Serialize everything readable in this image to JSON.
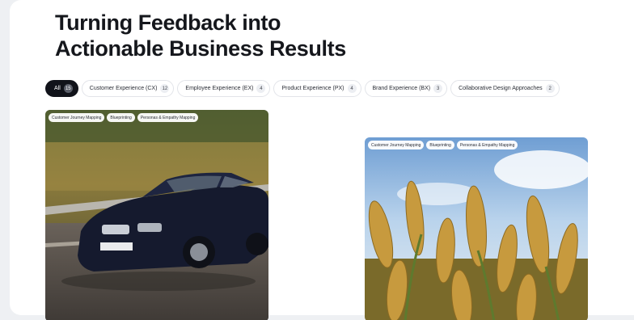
{
  "headline": {
    "line1": "Turning Feedback into",
    "line2": "Actionable Business Results"
  },
  "filters": [
    {
      "label": "All",
      "count": "15",
      "active": true
    },
    {
      "label": "Customer Experience (CX)",
      "count": "12"
    },
    {
      "label": "Employee Experience (EX)",
      "count": "4"
    },
    {
      "label": "Product Experience (PX)",
      "count": "4"
    },
    {
      "label": "Brand Experience (BX)",
      "count": "3"
    },
    {
      "label": "Collaborative Design Approaches",
      "count": "2"
    }
  ],
  "cards": [
    {
      "image": "car-on-road-photo",
      "tags": [
        "Customer Journey Mapping",
        "Blueprinting",
        "Personas & Empathy Mapping"
      ]
    },
    {
      "image": "wheat-field-photo",
      "tags": [
        "Customer Journey Mapping",
        "Blueprinting",
        "Personas & Empathy Mapping"
      ]
    }
  ],
  "colors": {
    "accent": "#11131a",
    "background": "#eef0f3",
    "panel": "#ffffff"
  }
}
